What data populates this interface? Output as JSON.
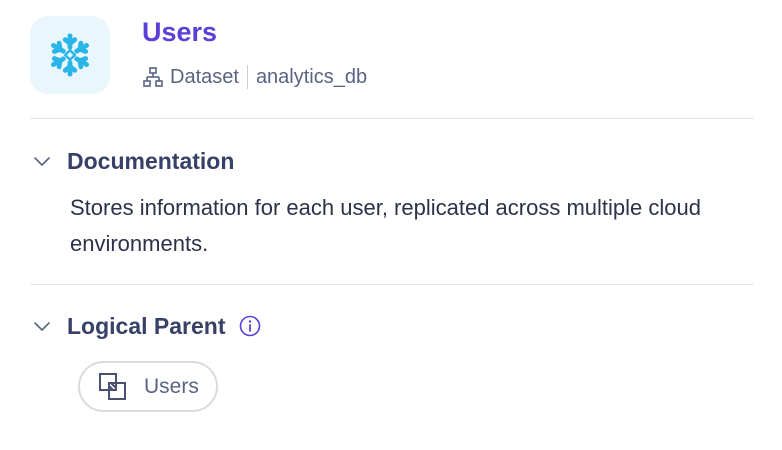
{
  "header": {
    "title": "Users",
    "entity_type": "Dataset",
    "container": "analytics_db",
    "platform_icon": "snowflake-icon",
    "type_icon": "hierarchy-icon"
  },
  "sections": {
    "documentation": {
      "label": "Documentation",
      "body": "Stores information for each user, replicated across multiple cloud environments."
    },
    "logical_parent": {
      "label": "Logical Parent",
      "info_icon": "info-icon",
      "chip": {
        "label": "Users",
        "icon": "overlapping-squares-icon"
      }
    }
  },
  "colors": {
    "accent": "#5b3fd6",
    "snowflake": "#29b5e8",
    "logo_bg": "#e9f6fc",
    "text": "#374066",
    "muted": "#5a6382",
    "divider": "#e3e5ea"
  }
}
